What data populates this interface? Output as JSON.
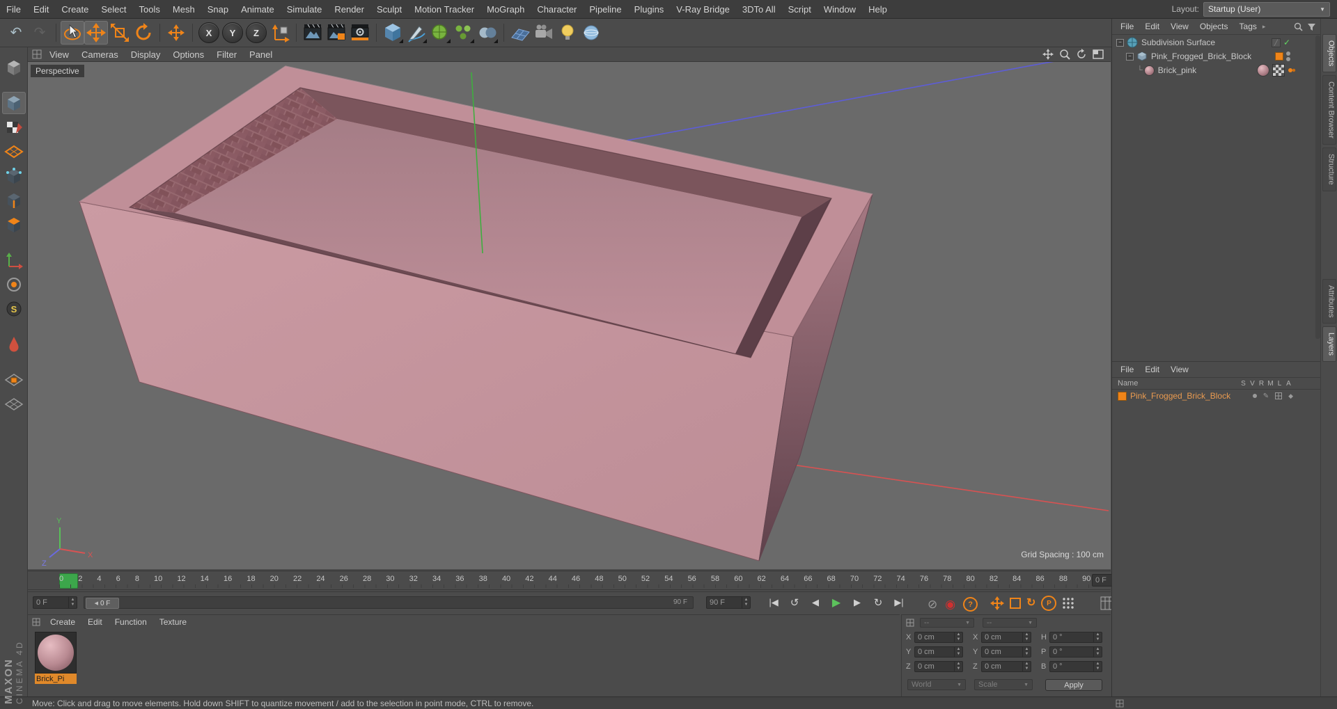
{
  "menubar": {
    "items": [
      "File",
      "Edit",
      "Create",
      "Select",
      "Tools",
      "Mesh",
      "Snap",
      "Animate",
      "Simulate",
      "Render",
      "Sculpt",
      "Motion Tracker",
      "MoGraph",
      "Character",
      "Pipeline",
      "Plugins",
      "V-Ray Bridge",
      "3DTo All",
      "Script",
      "Window",
      "Help"
    ],
    "layout_label": "Layout:",
    "layout_value": "Startup (User)"
  },
  "viewport": {
    "menu": [
      "View",
      "Cameras",
      "Display",
      "Options",
      "Filter",
      "Panel"
    ],
    "label": "Perspective",
    "grid_spacing": "Grid Spacing : 100 cm",
    "gizmo": {
      "x": "X",
      "y": "Y",
      "z": "Z"
    }
  },
  "object_manager": {
    "menu": [
      "File",
      "Edit",
      "View",
      "Objects",
      "Tags"
    ],
    "rows": [
      {
        "label": "Subdivision Surface"
      },
      {
        "label": "Pink_Frogged_Brick_Block"
      },
      {
        "label": "Brick_pink"
      }
    ]
  },
  "layer_manager": {
    "menu": [
      "File",
      "Edit",
      "View"
    ],
    "name_header": "Name",
    "columns": [
      "S",
      "V",
      "R",
      "M",
      "L",
      "A"
    ],
    "rows": [
      {
        "label": "Pink_Frogged_Brick_Block"
      }
    ]
  },
  "side_tabs": {
    "top": [
      "Objects",
      "Content Browser",
      "Structure"
    ],
    "bottom": [
      "Attributes",
      "Layers"
    ]
  },
  "materials": {
    "menu": [
      "Create",
      "Edit",
      "Function",
      "Texture"
    ],
    "items": [
      {
        "label": "Brick_Pi"
      }
    ]
  },
  "coordinates": {
    "header": [
      "--",
      "--"
    ],
    "position": {
      "x_label": "X",
      "y_label": "Y",
      "z_label": "Z",
      "x": "0 cm",
      "y": "0 cm",
      "z": "0 cm"
    },
    "size": {
      "x_label": "X",
      "y_label": "Y",
      "z_label": "Z",
      "x": "0 cm",
      "y": "0 cm",
      "z": "0 cm"
    },
    "rotation": {
      "h_label": "H",
      "p_label": "P",
      "b_label": "B",
      "h": "0 °",
      "p": "0 °",
      "b": "0 °"
    },
    "space_dropdown": "World",
    "mode_dropdown": "Scale",
    "apply": "Apply"
  },
  "timeline": {
    "labels": [
      "0",
      "2",
      "4",
      "6",
      "8",
      "10",
      "12",
      "14",
      "16",
      "18",
      "20",
      "22",
      "24",
      "26",
      "28",
      "30",
      "32",
      "34",
      "36",
      "38",
      "40",
      "42",
      "44",
      "46",
      "48",
      "50",
      "52",
      "54",
      "56",
      "58",
      "60",
      "62",
      "64",
      "66",
      "68",
      "70",
      "72",
      "74",
      "76",
      "78",
      "80",
      "82",
      "84",
      "86",
      "88",
      "90"
    ],
    "ruler_field": "0 F",
    "start_field": "0 F",
    "end_field": "90 F",
    "slider_handle": "0 F",
    "slider_end": "90 F"
  },
  "status_bar": {
    "text": "Move: Click and drag to move elements. Hold down SHIFT to quantize movement / add to the selection in point mode, CTRL to remove."
  },
  "branding": {
    "line1": "MAXON",
    "line2": "CINEMA 4D"
  }
}
